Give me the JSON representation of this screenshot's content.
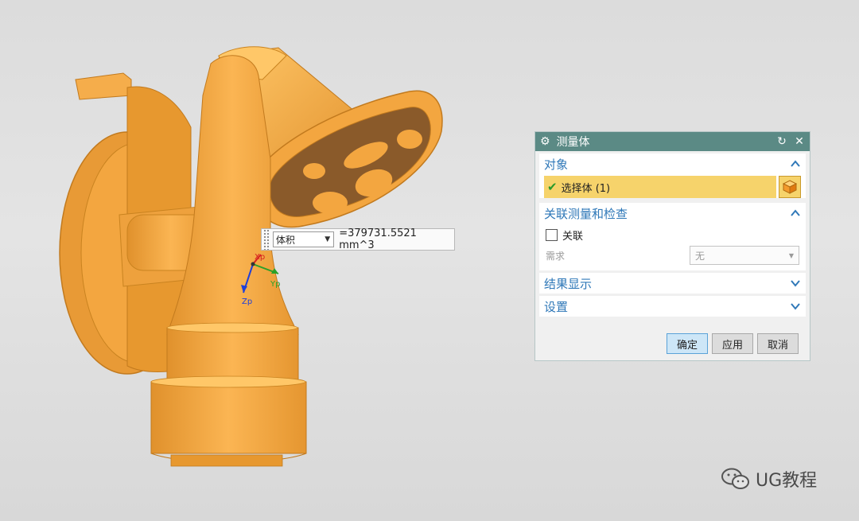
{
  "readout": {
    "type": "体积",
    "value": "=379731.5521 mm^3"
  },
  "triad": {
    "x": "Xp",
    "y": "Yp",
    "z": "Zp"
  },
  "dialog": {
    "title": "测量体",
    "sections": {
      "object": {
        "label": "对象"
      },
      "selection": {
        "label": "选择体 (1)"
      },
      "assoc": {
        "label": "关联测量和检查",
        "checkbox_label": "关联",
        "checked": false,
        "require_label": "需求",
        "require_value": "无"
      },
      "results": {
        "label": "结果显示"
      },
      "settings": {
        "label": "设置"
      }
    },
    "buttons": {
      "ok": "确定",
      "apply": "应用",
      "cancel": "取消"
    }
  },
  "watermark": {
    "text": "UG教程"
  },
  "colors": {
    "part": "#f3a640",
    "part_shadow": "#d98a26",
    "part_highlight": "#ffc768",
    "title_bar": "#5b8a85",
    "section_head": "#2f78b8",
    "selection_bar": "#f6d36b"
  },
  "icons": [
    "gear-icon",
    "reset-icon",
    "close-icon",
    "chevron-up-icon",
    "chevron-down-icon",
    "check-icon",
    "cube-icon",
    "dropdown-arrow-icon",
    "wechat-icon"
  ]
}
